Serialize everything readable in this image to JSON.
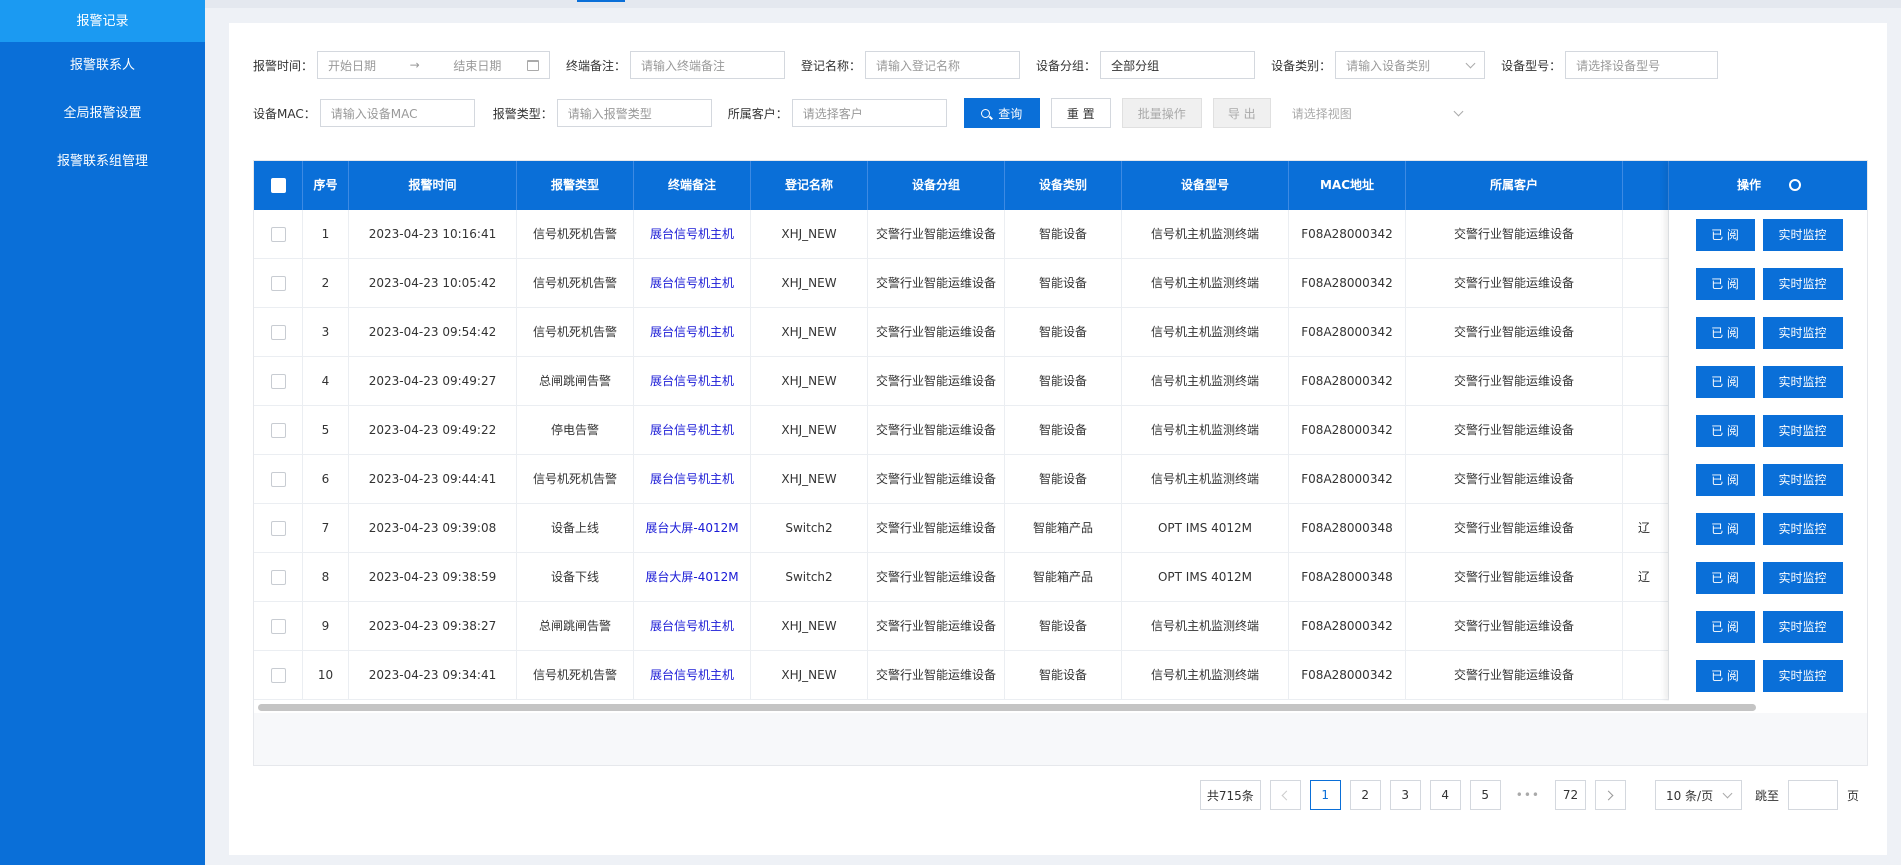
{
  "sidebar": {
    "items": [
      {
        "label": "报警记录",
        "active": true
      },
      {
        "label": "报警联系人"
      },
      {
        "label": "全局报警设置"
      },
      {
        "label": "报警联系组管理"
      }
    ]
  },
  "filters": {
    "alarm_time_label": "报警时间：",
    "start_date_placeholder": "开始日期",
    "end_date_placeholder": "结束日期",
    "terminal_note_label": "终端备注：",
    "terminal_note_placeholder": "请输入终端备注",
    "reg_name_label": "登记名称：",
    "reg_name_placeholder": "请输入登记名称",
    "device_group_label": "设备分组：",
    "device_group_value": "全部分组",
    "device_category_label": "设备类别：",
    "device_category_placeholder": "请输入设备类别",
    "device_model_label": "设备型号：",
    "device_model_placeholder": "请选择设备型号",
    "mac_label": "设备MAC：",
    "mac_placeholder": "请输入设备MAC",
    "alarm_type_label": "报警类型：",
    "alarm_type_placeholder": "请输入报警类型",
    "customer_label": "所属客户：",
    "customer_placeholder": "请选择客户",
    "search_button": "查询",
    "reset_button": "重 置",
    "batch_button": "批量操作",
    "export_button": "导 出",
    "view_placeholder": "请选择视图"
  },
  "table": {
    "columns": [
      "序号",
      "报警时间",
      "报警类型",
      "终端备注",
      "登记名称",
      "设备分组",
      "设备类别",
      "设备型号",
      "MAC地址",
      "所属客户",
      "",
      "操作"
    ],
    "read_button": "已 阅",
    "monitor_button": "实时监控",
    "rows": [
      {
        "no": "1",
        "time": "2023-04-23 10:16:41",
        "type": "信号机死机告警",
        "note": "展台信号机主机",
        "reg": "XHJ_NEW",
        "group": "交警行业智能运维设备",
        "cat": "智能设备",
        "model": "信号机主机监测终端",
        "mac": "F08A28000342",
        "customer": "交警行业智能运维设备",
        "extra": ""
      },
      {
        "no": "2",
        "time": "2023-04-23 10:05:42",
        "type": "信号机死机告警",
        "note": "展台信号机主机",
        "reg": "XHJ_NEW",
        "group": "交警行业智能运维设备",
        "cat": "智能设备",
        "model": "信号机主机监测终端",
        "mac": "F08A28000342",
        "customer": "交警行业智能运维设备",
        "extra": ""
      },
      {
        "no": "3",
        "time": "2023-04-23 09:54:42",
        "type": "信号机死机告警",
        "note": "展台信号机主机",
        "reg": "XHJ_NEW",
        "group": "交警行业智能运维设备",
        "cat": "智能设备",
        "model": "信号机主机监测终端",
        "mac": "F08A28000342",
        "customer": "交警行业智能运维设备",
        "extra": ""
      },
      {
        "no": "4",
        "time": "2023-04-23 09:49:27",
        "type": "总闸跳闸告警",
        "note": "展台信号机主机",
        "reg": "XHJ_NEW",
        "group": "交警行业智能运维设备",
        "cat": "智能设备",
        "model": "信号机主机监测终端",
        "mac": "F08A28000342",
        "customer": "交警行业智能运维设备",
        "extra": ""
      },
      {
        "no": "5",
        "time": "2023-04-23 09:49:22",
        "type": "停电告警",
        "note": "展台信号机主机",
        "reg": "XHJ_NEW",
        "group": "交警行业智能运维设备",
        "cat": "智能设备",
        "model": "信号机主机监测终端",
        "mac": "F08A28000342",
        "customer": "交警行业智能运维设备",
        "extra": ""
      },
      {
        "no": "6",
        "time": "2023-04-23 09:44:41",
        "type": "信号机死机告警",
        "note": "展台信号机主机",
        "reg": "XHJ_NEW",
        "group": "交警行业智能运维设备",
        "cat": "智能设备",
        "model": "信号机主机监测终端",
        "mac": "F08A28000342",
        "customer": "交警行业智能运维设备",
        "extra": ""
      },
      {
        "no": "7",
        "time": "2023-04-23 09:39:08",
        "type": "设备上线",
        "note": "展台大屏-4012M",
        "reg": "Switch2",
        "group": "交警行业智能运维设备",
        "cat": "智能箱产品",
        "model": "OPT IMS 4012M",
        "mac": "F08A28000348",
        "customer": "交警行业智能运维设备",
        "extra": "辽"
      },
      {
        "no": "8",
        "time": "2023-04-23 09:38:59",
        "type": "设备下线",
        "note": "展台大屏-4012M",
        "reg": "Switch2",
        "group": "交警行业智能运维设备",
        "cat": "智能箱产品",
        "model": "OPT IMS 4012M",
        "mac": "F08A28000348",
        "customer": "交警行业智能运维设备",
        "extra": "辽"
      },
      {
        "no": "9",
        "time": "2023-04-23 09:38:27",
        "type": "总闸跳闸告警",
        "note": "展台信号机主机",
        "reg": "XHJ_NEW",
        "group": "交警行业智能运维设备",
        "cat": "智能设备",
        "model": "信号机主机监测终端",
        "mac": "F08A28000342",
        "customer": "交警行业智能运维设备",
        "extra": ""
      },
      {
        "no": "10",
        "time": "2023-04-23 09:34:41",
        "type": "信号机死机告警",
        "note": "展台信号机主机",
        "reg": "XHJ_NEW",
        "group": "交警行业智能运维设备",
        "cat": "智能设备",
        "model": "信号机主机监测终端",
        "mac": "F08A28000342",
        "customer": "交警行业智能运维设备",
        "extra": ""
      }
    ]
  },
  "pagination": {
    "total": "共715条",
    "pages": [
      "1",
      "2",
      "3",
      "4",
      "5"
    ],
    "dots": "•••",
    "last": "72",
    "page_size": "10 条/页",
    "jump_label": "跳至",
    "page_suffix": "页"
  },
  "colors": {
    "primary": "#0a6fd8",
    "sidebar_active": "#1b9af2",
    "link": "#1a1ad6"
  }
}
